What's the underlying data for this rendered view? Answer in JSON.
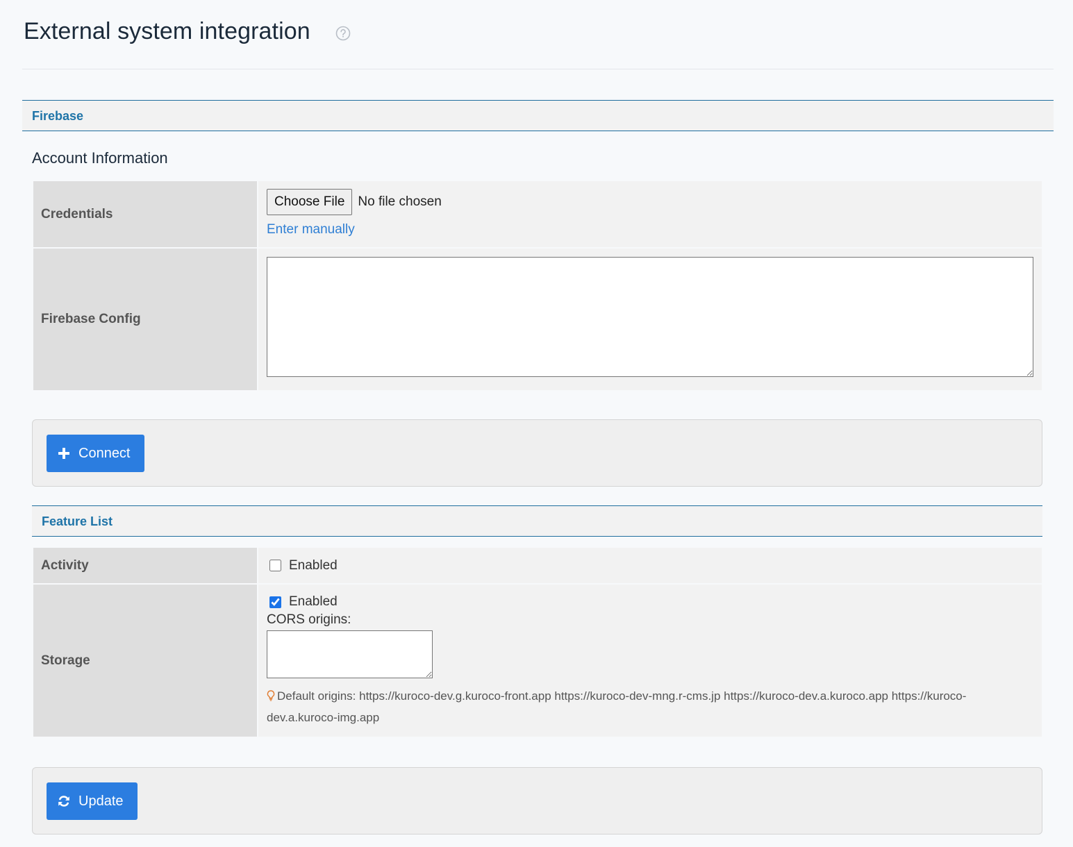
{
  "header": {
    "title": "External system integration",
    "help_icon": "question-circle-icon"
  },
  "firebase_section": {
    "title": "Firebase"
  },
  "account_information": {
    "heading": "Account Information",
    "credentials": {
      "label": "Credentials",
      "choose_file_label": "Choose File",
      "no_file_text": "No file chosen",
      "enter_manually_link": "Enter manually"
    },
    "firebase_config": {
      "label": "Firebase Config",
      "value": ""
    }
  },
  "connect_button": {
    "label": "Connect",
    "icon": "plus-icon"
  },
  "feature_list": {
    "title": "Feature List",
    "activity": {
      "label": "Activity",
      "checkbox_label": "Enabled",
      "checked": false
    },
    "storage": {
      "label": "Storage",
      "checkbox_label": "Enabled",
      "checked": true,
      "cors_label": "CORS origins:",
      "cors_value": "",
      "hint_icon": "lightbulb-icon",
      "hint_text": "Default origins: https://kuroco-dev.g.kuroco-front.app https://kuroco-dev-mng.r-cms.jp https://kuroco-dev.a.kuroco.app https://kuroco-dev.a.kuroco-img.app"
    }
  },
  "update_button": {
    "label": "Update",
    "icon": "refresh-icon"
  },
  "colors": {
    "accent": "#2b7de0",
    "section_border": "#1f6e9e",
    "link": "#2f7fd4",
    "hint_icon": "#e07a2e"
  }
}
